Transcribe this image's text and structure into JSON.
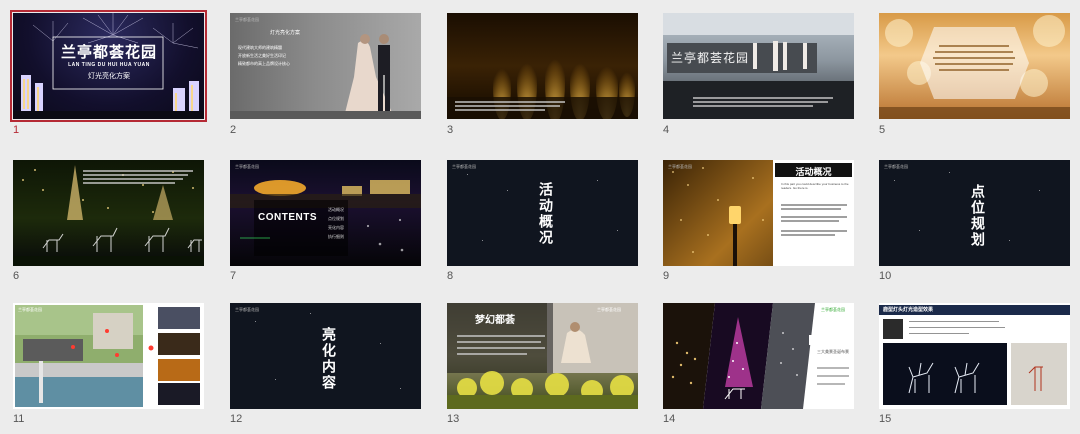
{
  "slides": [
    {
      "number": "1",
      "title": "兰亭都荟花园",
      "subtitle": "LAN TING DU HUI HUA YUAN",
      "caption": "灯光亮化方案"
    },
    {
      "number": "2",
      "tag": "兰亭都荟花园",
      "headline": "灯光亮化方案",
      "lines": [
        "现代建筑大师的建筑精髓",
        "开放新生活之美好生活印记",
        "精致都市的高上品牌设计核心"
      ]
    },
    {
      "number": "3",
      "caption": "灯光亮化方案"
    },
    {
      "number": "4",
      "sign": "兰亭都荟花园",
      "caption": "灯光亮化方案"
    },
    {
      "number": "5",
      "caption": "灯光亮化方案"
    },
    {
      "number": "6",
      "caption": "灯光亮化方案"
    },
    {
      "number": "7",
      "tag": "兰亭都荟花园",
      "heading": "CONTENTS",
      "items": [
        "活动概况",
        "点位规划",
        "亮化内容",
        "执行细则"
      ]
    },
    {
      "number": "8",
      "tag": "兰亭都荟花园",
      "vertical_title": "活动概况"
    },
    {
      "number": "9",
      "tag": "兰亭都荟花园",
      "heading": "活动概况",
      "caption": "In this part you could describe your business to the readers. Go there is."
    },
    {
      "number": "10",
      "tag": "兰亭都荟花园",
      "vertical_title": "点位规划"
    },
    {
      "number": "11",
      "tag": "兰亭都荟花园"
    },
    {
      "number": "12",
      "tag": "兰亭都荟花园",
      "vertical_title": "亮化内容"
    },
    {
      "number": "13",
      "tag": "兰亭都荟花园",
      "heading": "梦幻都荟"
    },
    {
      "number": "14",
      "tag": "兰亭都荟花园",
      "caption": "三大美景圣诞布景"
    },
    {
      "number": "15",
      "tag": "兰亭都荟花园",
      "heading": "鹿型灯头灯光造型效果"
    }
  ]
}
